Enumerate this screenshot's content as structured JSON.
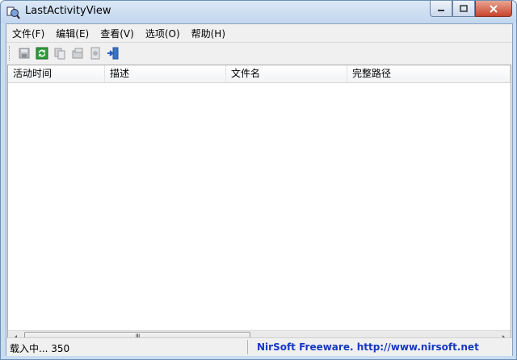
{
  "window": {
    "title": "LastActivityView"
  },
  "menu": [
    {
      "label": "文件(F)"
    },
    {
      "label": "编辑(E)"
    },
    {
      "label": "查看(V)"
    },
    {
      "label": "选项(O)"
    },
    {
      "label": "帮助(H)"
    }
  ],
  "toolbar": {
    "icons": [
      "save-icon",
      "refresh-icon",
      "copy-icon",
      "properties-icon",
      "html-report-icon",
      "exit-icon"
    ]
  },
  "list": {
    "columns": [
      {
        "label": "活动时间"
      },
      {
        "label": "描述"
      },
      {
        "label": "文件名"
      },
      {
        "label": "完整路径"
      }
    ],
    "scrollbar_grip": "III"
  },
  "status": {
    "left": "载入中... 350",
    "right": "NirSoft Freeware.  http://www.nirsoft.net"
  },
  "colors": {
    "status_link": "#1538c4",
    "titlebar": "#c9dcf0"
  }
}
